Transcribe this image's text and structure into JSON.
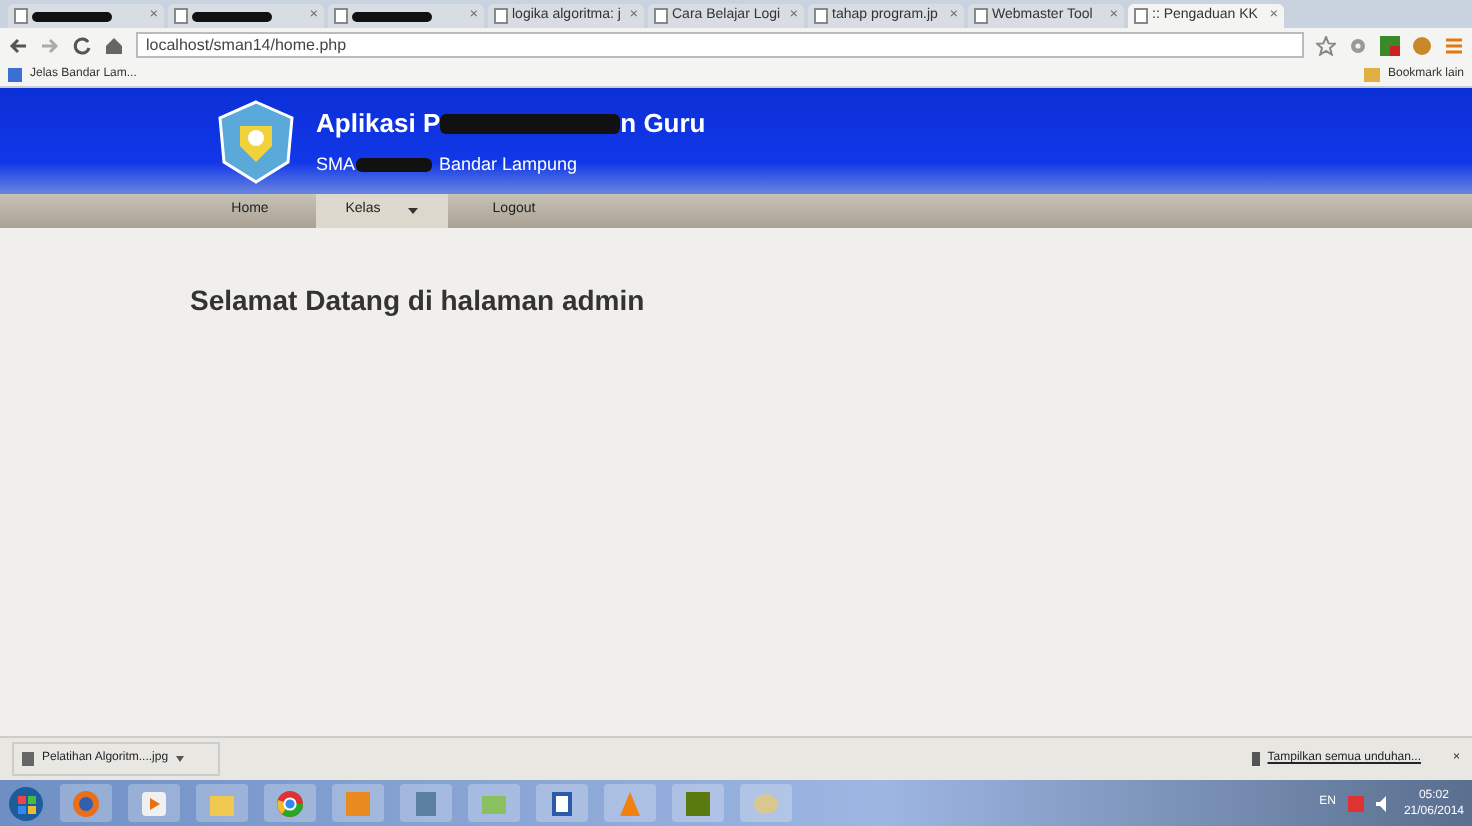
{
  "browser": {
    "tabs": [
      {
        "redacted": true,
        "selected": false
      },
      {
        "redacted": true,
        "selected": false
      },
      {
        "redacted": true,
        "selected": false
      },
      {
        "label": "logika algoritma: j",
        "redacted": false,
        "selected": false
      },
      {
        "label": "Cara Belajar Logi",
        "redacted": false,
        "selected": false
      },
      {
        "label": "tahap program.jp",
        "redacted": false,
        "selected": false
      },
      {
        "label": "Webmaster Tool",
        "redacted": false,
        "selected": false
      },
      {
        "label": ":: Pengaduan KK",
        "redacted": false,
        "selected": true
      }
    ],
    "close_glyph": "×",
    "address": "localhost/sman14/home.php",
    "bookmarks": [
      {
        "label": "Jelas Bandar Lam..."
      }
    ],
    "other_bookmarks": "Bookmark lain"
  },
  "header": {
    "title_start": "Aplikasi P",
    "title_end": "n Guru",
    "subtitle_start": "SMA",
    "subtitle_end": "Bandar Lampung"
  },
  "nav": [
    {
      "label": "Home",
      "dropdown": false,
      "selected": false
    },
    {
      "label": "Kelas",
      "dropdown": true,
      "selected": true
    },
    {
      "label": "Logout",
      "dropdown": false,
      "selected": false
    }
  ],
  "content": {
    "heading": "Selamat Datang di halaman admin"
  },
  "download_bar": {
    "file": "Pelatihan Algoritm....jpg",
    "show_all": "Tampilkan semua unduhan...",
    "close": "×"
  },
  "taskbar": {
    "apps": [
      {
        "kind": "firefox"
      },
      {
        "kind": "media"
      },
      {
        "kind": "folder"
      },
      {
        "kind": "chrome"
      },
      {
        "kind": "orange"
      },
      {
        "kind": "notepad"
      },
      {
        "kind": "photos"
      },
      {
        "kind": "word"
      },
      {
        "kind": "vlc"
      },
      {
        "kind": "dw"
      },
      {
        "kind": "paint"
      }
    ],
    "lang": "EN",
    "time": "05:02",
    "date": "21/06/2014"
  }
}
